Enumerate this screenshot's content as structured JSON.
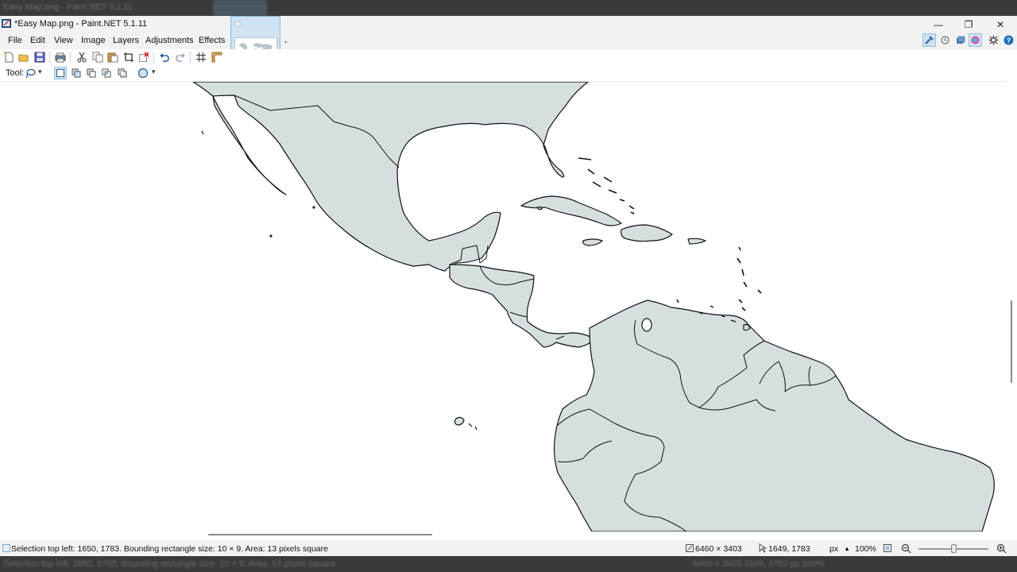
{
  "background": {
    "ghost_title": "Easy Map.png - Paint.NET 5.1.11",
    "ghost_status": "Selection top left: 1650, 1783. Bounding rectangle size: 10 × 9. Area: 13 pixels square",
    "ghost_right": "6460 × 3403    1649, 1783    px  100%"
  },
  "window": {
    "title": "*Easy Map.png - Paint.NET 5.1.11",
    "controls": {
      "minimize": "—",
      "restore": "❐",
      "close": "✕"
    }
  },
  "menu": {
    "items": [
      "File",
      "Edit",
      "View",
      "Image",
      "Layers",
      "Adjustments",
      "Effects"
    ]
  },
  "document_tab": {
    "dropdown": "⌄"
  },
  "right_toolbar": {
    "icons": [
      "tools-icon",
      "history-icon",
      "layers-icon",
      "colors-icon",
      "settings-icon",
      "help-icon"
    ],
    "accent": "#1e6fb8"
  },
  "toolbar": {
    "icons": [
      "new-icon",
      "open-icon",
      "save-icon",
      "print-icon",
      "cut-icon",
      "copy-icon",
      "paste-icon",
      "crop-icon",
      "deselect-icon",
      "undo-icon",
      "redo-icon",
      "grid-icon",
      "ruler-icon"
    ]
  },
  "tool_options": {
    "label": "Tool:",
    "tool_dropdown": "▾",
    "modes": [
      "replace-mode-icon",
      "union-mode-icon",
      "exclude-mode-icon",
      "intersect-mode-icon",
      "invert-mode-icon"
    ],
    "sampling_dropdown": "▾"
  },
  "canvas": {
    "image_name": "Easy Map",
    "land_color": "#d6dfe0",
    "border_color": "#111111",
    "water_color": "#ffffff"
  },
  "status": {
    "selection_text": "Selection top left: 1650, 1783. Bounding rectangle size: 10 × 9. Area: 13 pixels square",
    "image_size": "6460 × 3403",
    "cursor_pos": "1649, 1783",
    "units": "px",
    "units_arrow": "▲",
    "zoom": "100%"
  }
}
